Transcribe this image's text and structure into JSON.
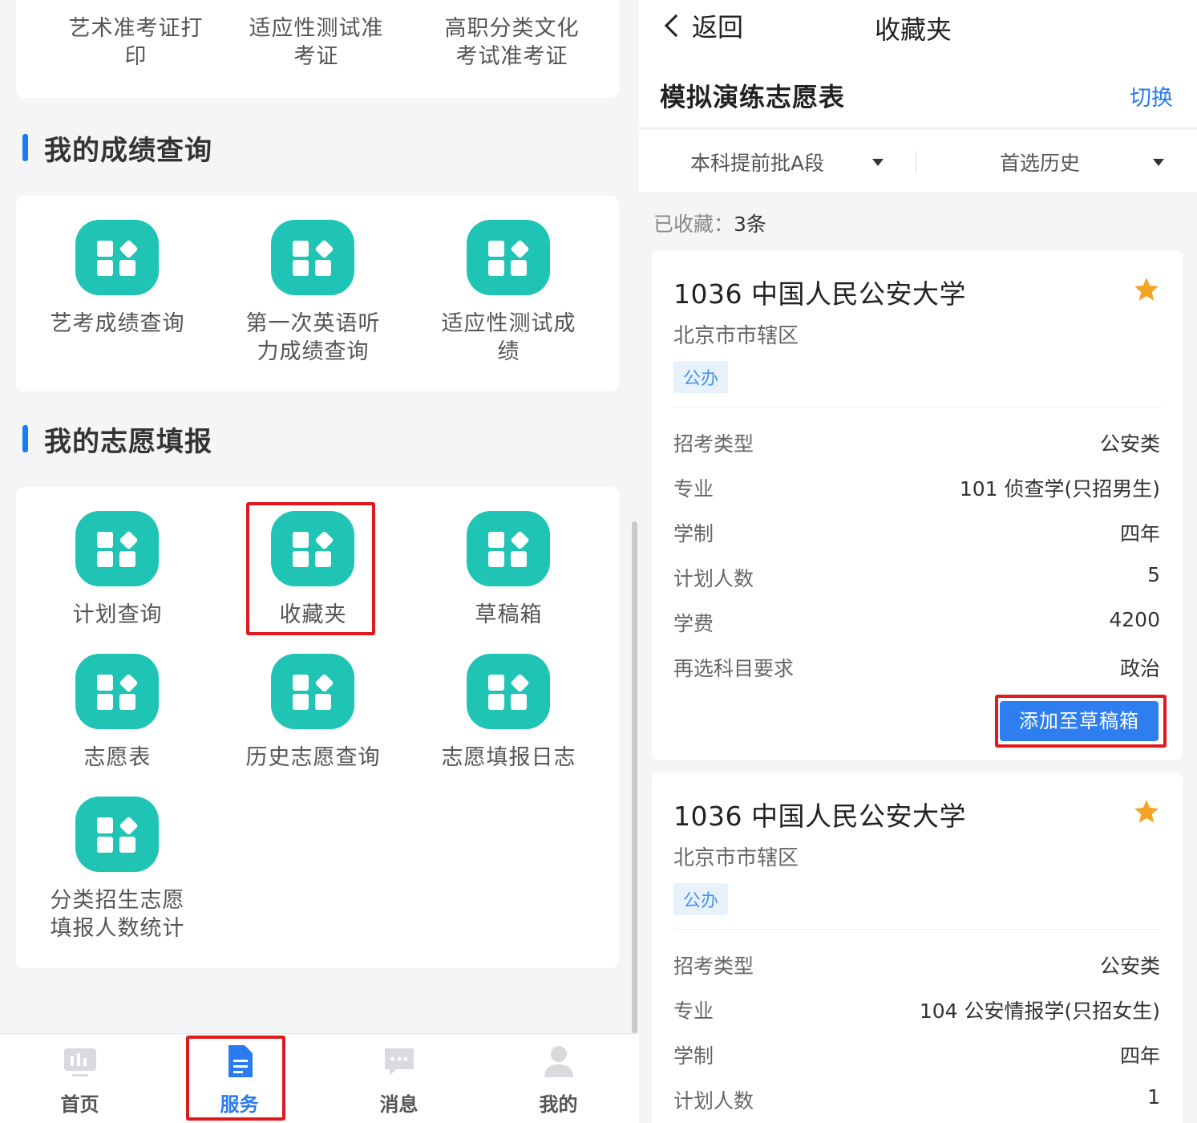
{
  "left": {
    "top_card": {
      "items": [
        "艺术准考证打\n印",
        "适应性测试准\n考证",
        "高职分类文化\n考试准考证"
      ]
    },
    "section_scores": {
      "title": "我的成绩查询",
      "items": [
        {
          "label": "艺考成绩查询",
          "icon": "grid-apps-icon"
        },
        {
          "label": "第一次英语听\n力成绩查询",
          "icon": "grid-apps-icon"
        },
        {
          "label": "适应性测试成\n绩",
          "icon": "grid-apps-icon"
        }
      ]
    },
    "section_volunteer": {
      "title": "我的志愿填报",
      "items": [
        {
          "label": "计划查询",
          "icon": "grid-apps-icon"
        },
        {
          "label": "收藏夹",
          "icon": "grid-apps-icon"
        },
        {
          "label": "草稿箱",
          "icon": "grid-apps-icon"
        },
        {
          "label": "志愿表",
          "icon": "grid-apps-icon"
        },
        {
          "label": "历史志愿查询",
          "icon": "grid-apps-icon"
        },
        {
          "label": "志愿填报日志",
          "icon": "grid-apps-icon"
        },
        {
          "label": "分类招生志愿\n填报人数统计",
          "icon": "grid-apps-icon"
        }
      ]
    },
    "tabbar": [
      {
        "label": "首页",
        "icon": "home-chart-icon",
        "active": false
      },
      {
        "label": "服务",
        "icon": "document-icon",
        "active": true
      },
      {
        "label": "消息",
        "icon": "message-icon",
        "active": false
      },
      {
        "label": "我的",
        "icon": "user-icon",
        "active": false
      }
    ]
  },
  "right": {
    "nav": {
      "back_label": "返回",
      "title": "收藏夹"
    },
    "sub_title": "模拟演练志愿表",
    "switch_label": "切换",
    "filters": {
      "batch": "本科提前批A段",
      "subject": "首选历史"
    },
    "count_label": "已收藏：",
    "count_value": "3条",
    "cards": [
      {
        "school": "1036 中国人民公安大学",
        "region": "北京市市辖区",
        "badge": "公办",
        "rows": [
          {
            "k": "招考类型",
            "v": "公安类"
          },
          {
            "k": "专业",
            "v": "101 侦查学(只招男生)"
          },
          {
            "k": "学制",
            "v": "四年"
          },
          {
            "k": "计划人数",
            "v": "5"
          },
          {
            "k": "学费",
            "v": "4200"
          },
          {
            "k": "再选科目要求",
            "v": "政治"
          }
        ],
        "button": "添加至草稿箱"
      },
      {
        "school": "1036 中国人民公安大学",
        "region": "北京市市辖区",
        "badge": "公办",
        "rows": [
          {
            "k": "招考类型",
            "v": "公安类"
          },
          {
            "k": "专业",
            "v": "104 公安情报学(只招女生)"
          },
          {
            "k": "学制",
            "v": "四年"
          },
          {
            "k": "计划人数",
            "v": "1"
          }
        ]
      }
    ],
    "colors": {
      "accent": "#2b7bf0",
      "teal": "#1fc4b4",
      "star": "#f4a428",
      "highlight": "#e0191d"
    }
  }
}
